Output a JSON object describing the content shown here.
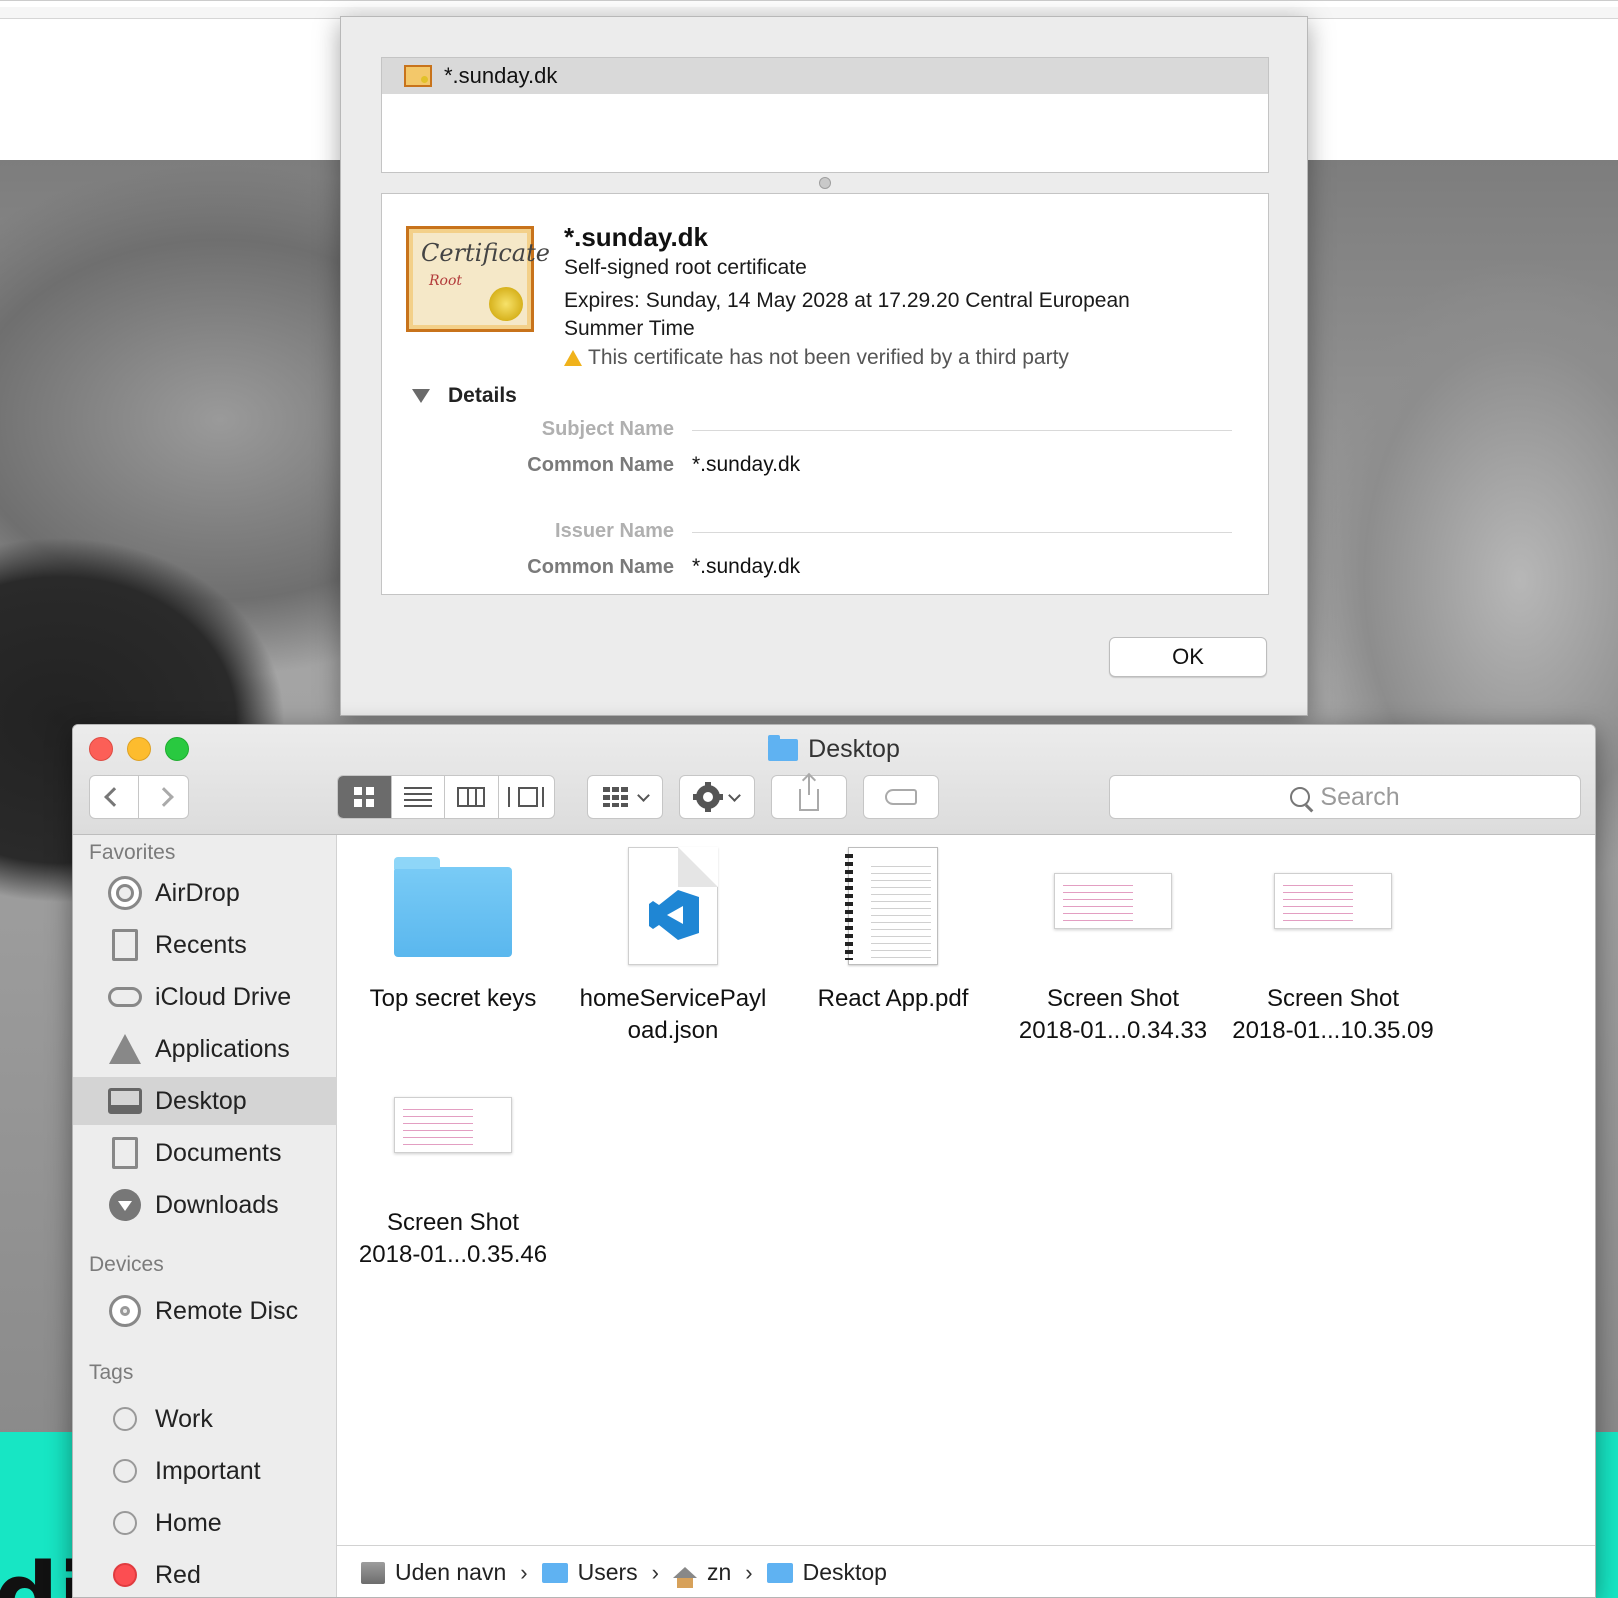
{
  "certificate_dialog": {
    "list_item": "*.sunday.dk",
    "title": "*.sunday.dk",
    "subtitle": "Self-signed root certificate",
    "expires": "Expires: Sunday, 14 May 2028 at 17.29.20 Central European Summer Time",
    "warning": "This certificate has not been verified by a third party",
    "details_label": "Details",
    "icon_text_1": "Certificate",
    "icon_text_2": "Root",
    "subject_section": "Subject Name",
    "subject_common_name_label": "Common Name",
    "subject_common_name_value": "*.sunday.dk",
    "issuer_section": "Issuer Name",
    "issuer_common_name_label": "Common Name",
    "issuer_common_name_value": "*.sunday.dk",
    "ok_label": "OK"
  },
  "finder": {
    "window_title": "Desktop",
    "search_placeholder": "Search",
    "sidebar": {
      "favorites_header": "Favorites",
      "favorites": [
        {
          "label": "AirDrop",
          "icon": "airdrop-icon"
        },
        {
          "label": "Recents",
          "icon": "recents-icon"
        },
        {
          "label": "iCloud Drive",
          "icon": "cloud-icon"
        },
        {
          "label": "Applications",
          "icon": "applications-icon"
        },
        {
          "label": "Desktop",
          "icon": "desktop-icon",
          "selected": true
        },
        {
          "label": "Documents",
          "icon": "documents-icon"
        },
        {
          "label": "Downloads",
          "icon": "downloads-icon"
        }
      ],
      "devices_header": "Devices",
      "devices": [
        {
          "label": "Remote Disc",
          "icon": "disc-icon"
        }
      ],
      "tags_header": "Tags",
      "tags": [
        {
          "label": "Work",
          "color": "none"
        },
        {
          "label": "Important",
          "color": "none"
        },
        {
          "label": "Home",
          "color": "none"
        },
        {
          "label": "Red",
          "color": "#fc4e52"
        }
      ]
    },
    "files": [
      {
        "line1": "Top secret keys",
        "line2": "",
        "kind": "folder"
      },
      {
        "line1": "homeServicePayl",
        "line2": "oad.json",
        "kind": "json"
      },
      {
        "line1": "React App.pdf",
        "line2": "",
        "kind": "pdf"
      },
      {
        "line1": "Screen Shot",
        "line2": "2018-01...0.34.33",
        "kind": "screenshot"
      },
      {
        "line1": "Screen Shot",
        "line2": "2018-01...10.35.09",
        "kind": "screenshot"
      },
      {
        "line1": "Screen Shot",
        "line2": "2018-01...0.35.46",
        "kind": "screenshot"
      }
    ],
    "path": [
      "Uden navn",
      "Users",
      "zn",
      "Desktop"
    ],
    "path_separator": "›"
  },
  "colors": {
    "accent_teal": "#17e6c4",
    "folder_blue": "#5fb2f2",
    "close_red": "#fc5f57",
    "minimize_yellow": "#fdbc2e",
    "zoom_green": "#29c940"
  }
}
